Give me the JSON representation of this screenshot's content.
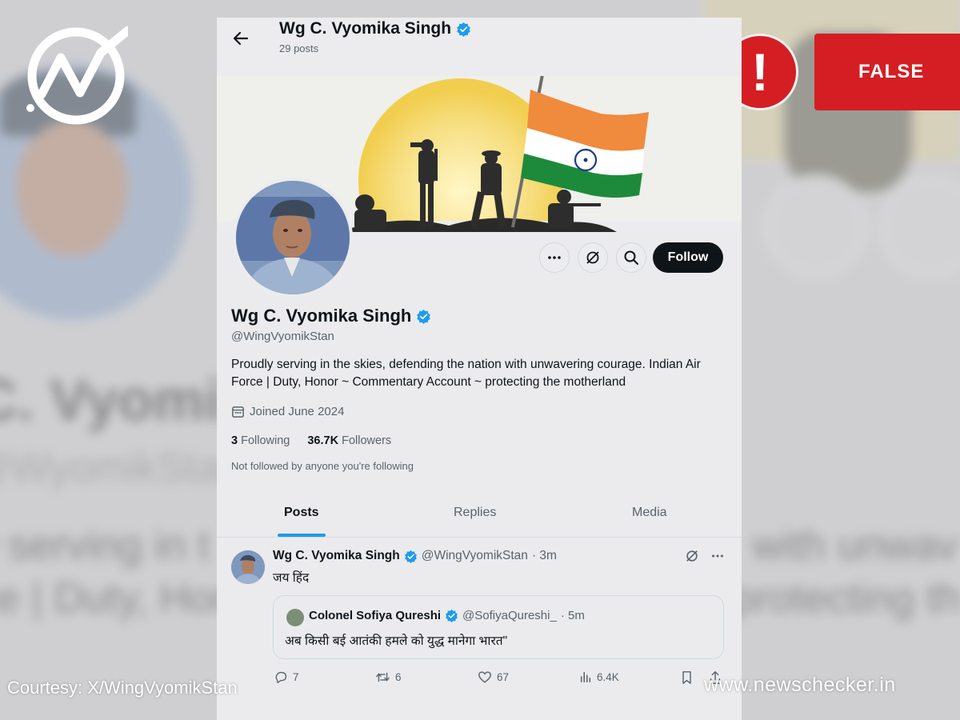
{
  "colors": {
    "alert_red": "#d41e24",
    "verified_blue": "#1d9bf0",
    "follow_button_bg": "#0f1419",
    "saffron": "#f08a3c",
    "flag_green": "#1d8a3b"
  },
  "background_text": {
    "name_fragment": "C. Vyomika",
    "handle_fragment": "@WyomikStan",
    "bio_line_1_left": "y serving in t",
    "bio_line_1_right": "with unwav",
    "bio_line_2_left": "ce | Duty, Hon",
    "bio_line_2_right": "protecting th"
  },
  "badge": {
    "alert_symbol": "!",
    "label": "FALSE"
  },
  "header": {
    "name": "Wg C. Vyomika Singh",
    "post_count": "29 posts",
    "back_icon": "arrow-left-icon"
  },
  "actions_bar": {
    "follow_label": "Follow",
    "more_icon": "more-horizontal-icon",
    "grok_icon": "grok-slash-icon",
    "search_icon": "search-icon"
  },
  "profile": {
    "name": "Wg C. Vyomika Singh",
    "handle": "@WingVyomikStan",
    "bio": "Proudly serving in the skies, defending the nation with unwavering courage. Indian Air Force | Duty, Honor ~ Commentary Account ~  protecting the motherland",
    "joined": "Joined June 2024",
    "following_count": "3",
    "following_label": "Following",
    "followers_count": "36.7K",
    "followers_label": "Followers",
    "not_followed_note": "Not followed by anyone you're following"
  },
  "tabs": [
    {
      "label": "Posts",
      "active": true
    },
    {
      "label": "Replies",
      "active": false
    },
    {
      "label": "Media",
      "active": false
    }
  ],
  "post": {
    "author": "Wg C. Vyomika Singh",
    "handle": "@WingVyomikStan",
    "time": "· 3m",
    "text": "जय हिंद",
    "quote": {
      "author": "Colonel Sofiya Qureshi",
      "handle": "@SofiyaQureshi_",
      "time": "· 5m",
      "text": "अब किसी बई आतंकी हमले को युद्ध मानेगा भारत\""
    },
    "replies": "7",
    "reposts": "6",
    "likes": "67",
    "views": "6.4K"
  },
  "footer": {
    "courtesy": "Courtesy: X/WingVyomikStan",
    "site": "www.newschecker.in"
  }
}
